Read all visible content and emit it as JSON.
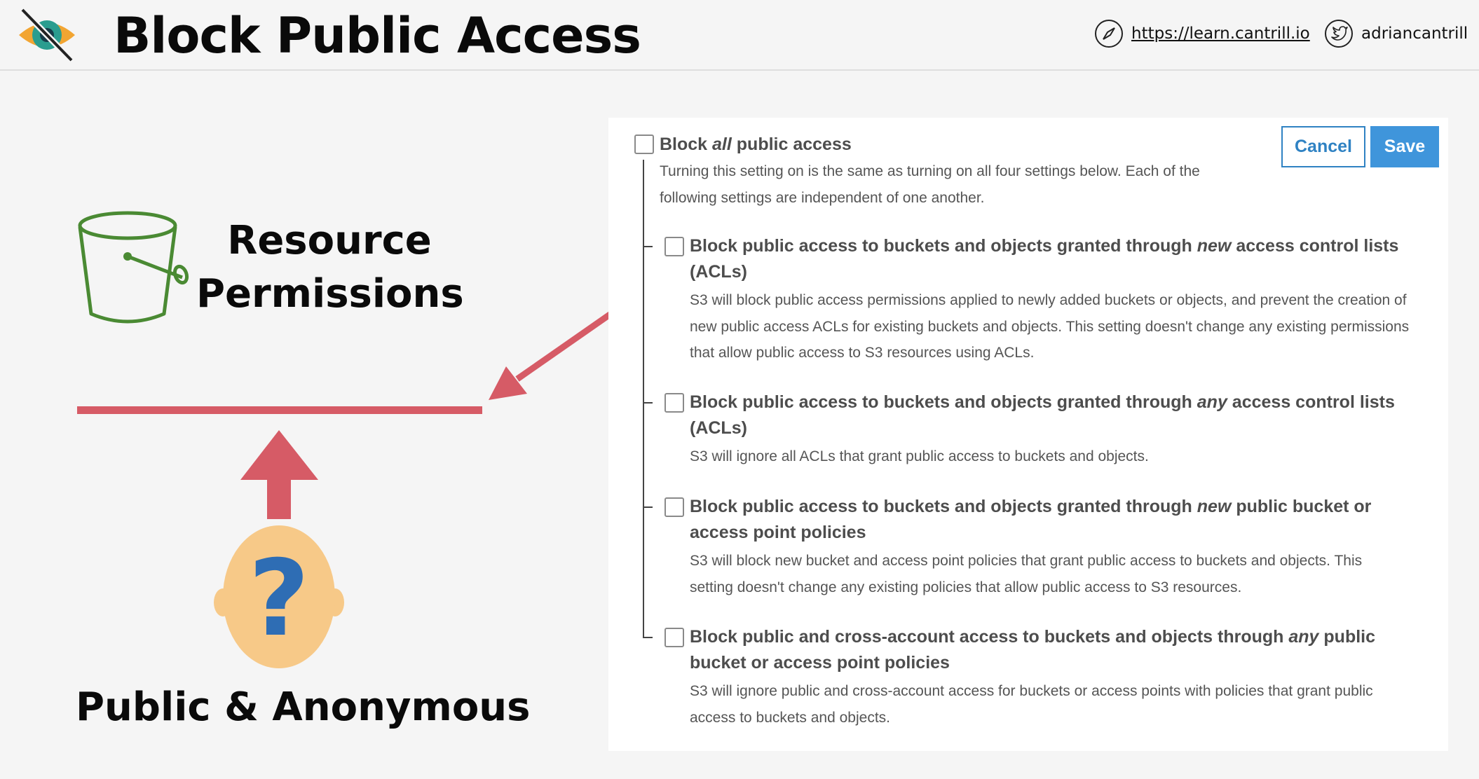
{
  "header": {
    "title": "Block Public Access",
    "site_url": "https://learn.cantrill.io",
    "twitter_handle": "adriancantrill",
    "logo_icon": "eye-slash-icon",
    "site_icon": "compass-icon",
    "twitter_icon": "twitter-bird-icon"
  },
  "diagram": {
    "resource_label_line1": "Resource",
    "resource_label_line2": "Permissions",
    "public_label": "Public & Anonymous",
    "person_symbol": "?",
    "bucket_icon": "s3-bucket-icon",
    "colors": {
      "arrow": "#d65b66",
      "bucket": "#4a8a33",
      "person_face": "#f7c988",
      "question_mark": "#2e6db4"
    }
  },
  "panel": {
    "cancel_label": "Cancel",
    "save_label": "Save",
    "block_all": {
      "prefix": "Block ",
      "em": "all",
      "suffix": " public access",
      "desc_line1": "Turning this setting on is the same as turning on all four settings below. Each of the",
      "desc_line2": "following settings are independent of one another.",
      "checked": false
    },
    "options": [
      {
        "prefix": "Block public access to buckets and objects granted through ",
        "em": "new",
        "suffix": " access control lists",
        "line2": "(ACLs)",
        "desc_lines": [
          "S3 will block public access permissions applied to newly added buckets or objects, and prevent the creation of",
          "new public access ACLs for existing buckets and objects. This setting doesn't change any existing permissions",
          "that allow public access to S3 resources using ACLs."
        ],
        "checked": false
      },
      {
        "prefix": "Block public access to buckets and objects granted through ",
        "em": "any",
        "suffix": " access control lists",
        "line2": "(ACLs)",
        "desc_lines": [
          "S3 will ignore all ACLs that grant public access to buckets and objects."
        ],
        "checked": false
      },
      {
        "prefix": "Block public access to buckets and objects granted through ",
        "em": "new",
        "suffix": " public bucket or",
        "line2": "access point policies",
        "desc_lines": [
          "S3 will block new bucket and access point policies that grant public access to buckets and objects. This",
          "setting doesn't change any existing policies that allow public access to S3 resources."
        ],
        "checked": false
      },
      {
        "prefix": "Block public and cross-account access to buckets and objects through ",
        "em": "any",
        "suffix": " public",
        "line2": "bucket or access point policies",
        "desc_lines": [
          "S3 will ignore public and cross-account access for buckets or access points with policies that grant public",
          "access to buckets and objects."
        ],
        "checked": false
      }
    ],
    "colors": {
      "primary": "#3f95db",
      "title_text": "#4d4d4d",
      "desc_text": "#555555"
    }
  }
}
